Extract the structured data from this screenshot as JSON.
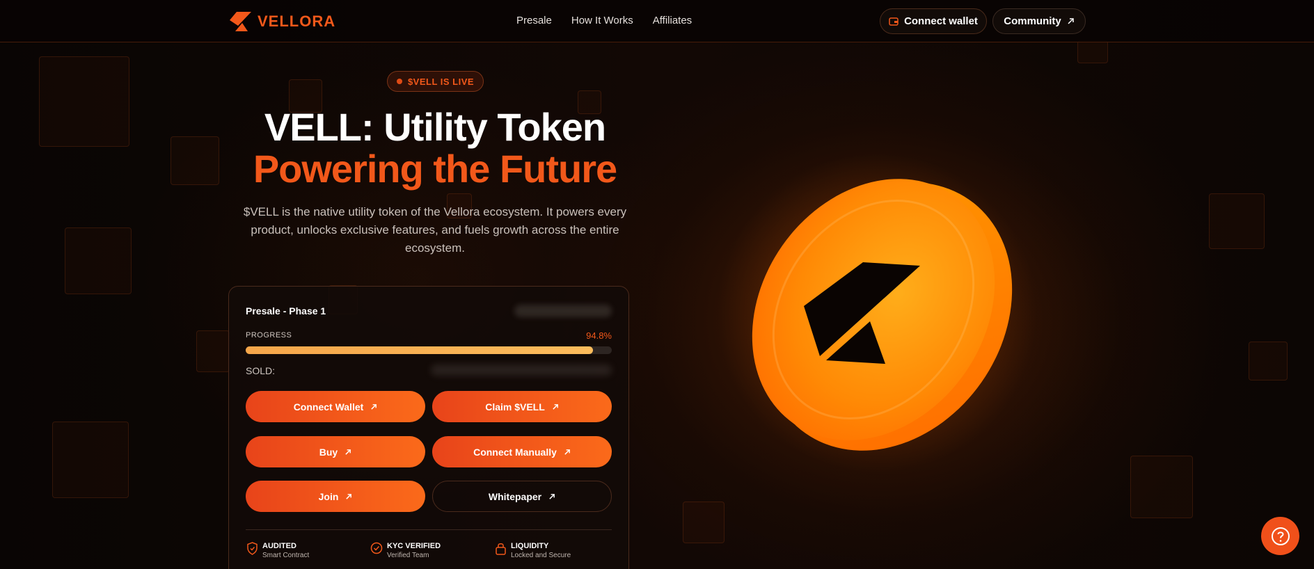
{
  "brand": {
    "name": "VELLORA",
    "accent": "#f2581a"
  },
  "nav": {
    "items": [
      "Presale",
      "How It Works",
      "Affiliates"
    ]
  },
  "header": {
    "connect_wallet": "Connect wallet",
    "community": "Community"
  },
  "hero": {
    "badge": "$VELL IS LIVE",
    "title_line1": "VELL: Utility Token",
    "title_line2": "Powering the Future",
    "description": "$VELL is the native utility token of the Vellora ecosystem. It powers every product, unlocks exclusive features, and fuels growth across the entire ecosystem."
  },
  "presale": {
    "title": "Presale - Phase 1",
    "progress_label": "PROGRESS",
    "progress_text": "94.8%",
    "progress_value": 94.8,
    "sold_label": "SOLD:",
    "buttons": {
      "connect_wallet": "Connect Wallet",
      "claim": "Claim $VELL",
      "buy": "Buy",
      "connect_manually": "Connect Manually",
      "join": "Join",
      "whitepaper": "Whitepaper"
    },
    "features": [
      {
        "title": "AUDITED",
        "subtitle": "Smart Contract",
        "icon": "shield-icon"
      },
      {
        "title": "KYC VERIFIED",
        "subtitle": "Verified Team",
        "icon": "check-badge-icon"
      },
      {
        "title": "LIQUIDITY",
        "subtitle": "Locked and Secure",
        "icon": "lock-icon"
      }
    ]
  },
  "help": {
    "icon": "help-icon"
  }
}
